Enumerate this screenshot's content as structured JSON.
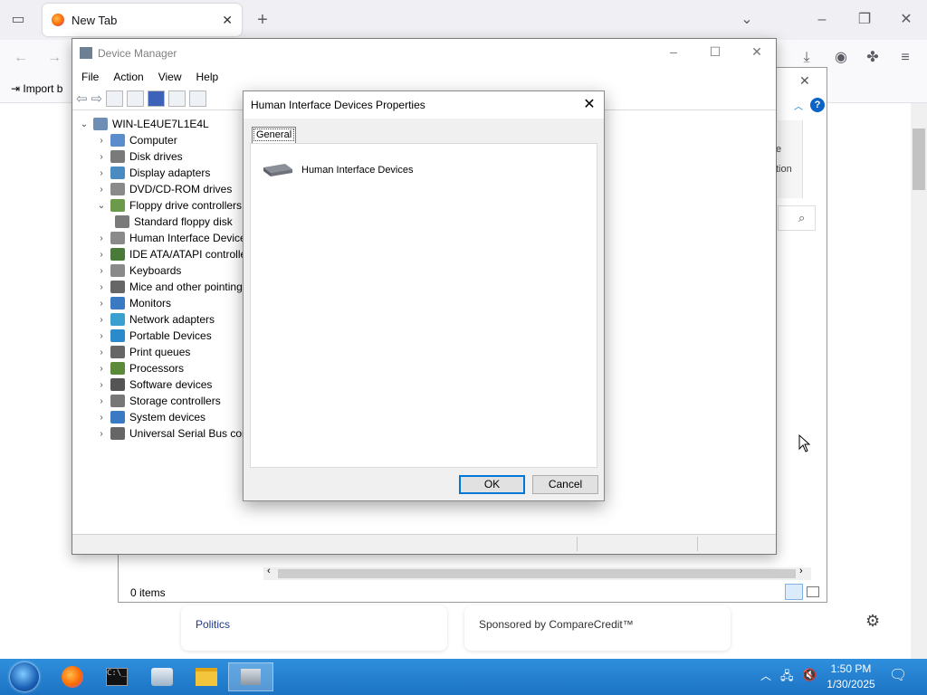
{
  "firefox": {
    "tab_title": "New Tab",
    "import_label": "Import b",
    "cards": {
      "left": "Politics",
      "right": "Sponsored by CompareCredit™"
    }
  },
  "background_window": {
    "items_count": "0 items",
    "partial_text": "tion",
    "partial_text2": "e"
  },
  "device_manager": {
    "title": "Device Manager",
    "menu": [
      "File",
      "Action",
      "View",
      "Help"
    ],
    "root": "WIN-LE4UE7L1E4L",
    "tree": [
      {
        "label": "Computer",
        "expanded": false
      },
      {
        "label": "Disk drives",
        "expanded": false
      },
      {
        "label": "Display adapters",
        "expanded": false
      },
      {
        "label": "DVD/CD-ROM drives",
        "expanded": false
      },
      {
        "label": "Floppy drive controllers",
        "expanded": true
      },
      {
        "label": "Standard floppy disk",
        "child": true
      },
      {
        "label": "Human Interface Device",
        "expanded": false
      },
      {
        "label": "IDE ATA/ATAPI controlle",
        "expanded": false
      },
      {
        "label": "Keyboards",
        "expanded": false
      },
      {
        "label": "Mice and other pointing",
        "expanded": false
      },
      {
        "label": "Monitors",
        "expanded": false
      },
      {
        "label": "Network adapters",
        "expanded": false
      },
      {
        "label": "Portable Devices",
        "expanded": false
      },
      {
        "label": "Print queues",
        "expanded": false
      },
      {
        "label": "Processors",
        "expanded": false
      },
      {
        "label": "Software devices",
        "expanded": false
      },
      {
        "label": "Storage controllers",
        "expanded": false
      },
      {
        "label": "System devices",
        "expanded": false
      },
      {
        "label": "Universal Serial Bus cont",
        "expanded": false
      }
    ]
  },
  "dialog": {
    "title": "Human Interface Devices Properties",
    "tab": "General",
    "device_name": "Human Interface Devices",
    "ok": "OK",
    "cancel": "Cancel"
  },
  "taskbar": {
    "time": "1:50 PM",
    "date": "1/30/2025"
  },
  "colors": {
    "accent": "#0078d7",
    "taskbar": "#1c73c4"
  }
}
